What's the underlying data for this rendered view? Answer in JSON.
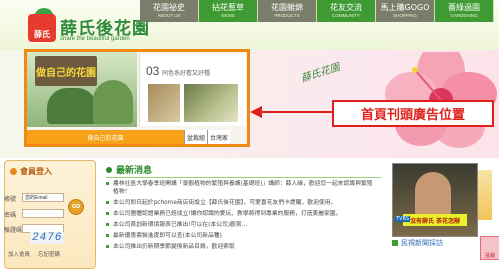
{
  "brand": {
    "logo_text": "薛氏",
    "title": "薛氏後花園",
    "subtitle": "share the beautiful garden"
  },
  "nav": [
    {
      "label": "花園祕史",
      "sublabel": "ABOUT US"
    },
    {
      "label": "拈花惹草",
      "sublabel": "NEWS"
    },
    {
      "label": "花園雜錦",
      "sublabel": "PRODUCTS"
    },
    {
      "label": "花友交流",
      "sublabel": "COMMUNITY"
    },
    {
      "label": "馬上購GOGO",
      "sublabel": "SHOPPING"
    },
    {
      "label": "薔綠過園",
      "sublabel": "GARDENING"
    }
  ],
  "banner": {
    "sign_text": "做自己的花園",
    "slide_number": "03",
    "slide_caption": "同色系好看又好種",
    "bar_caption": "做自己的花園",
    "tabs": [
      "盆栽組",
      "台灣家"
    ],
    "script_text": "薛氏花園"
  },
  "annotation": {
    "label": "首頁刊頭廣告位置",
    "arrow_color": "#e0201a"
  },
  "login": {
    "title": "會員登入",
    "account_label": "帳號",
    "account_value": "您的Email",
    "password_label": "密碼",
    "verify_label": "驗證碼",
    "go_label": "GO",
    "captcha": "2476",
    "links": [
      "加入會員",
      "忘記密碼"
    ]
  },
  "news": {
    "title": "最新消息",
    "items": [
      "農林社區大學春季班開講「景觀植物的繁殖與養護(基礎班)」講師：薛人緣，歡迎您一起來認識與繁殖植物！",
      "本公司即日起於pchome商店街設立【薛氏後花園】，可愛喜花友們卡提醒，歡迎使用。",
      "本公司團體認證業務已經成立!讓你認識的愛玩、教學將得到專業的服務，打造美麗家園。",
      "本公司首創新環境報表已推出!可以在(本公司)觀賞…",
      "最新優惠套裝進度即可以查(本公司新品種)",
      "本公司推出仍新期季節變換新品目錄，歡迎索取"
    ]
  },
  "video": {
    "caption": "沒有薛氏 茶花怎辦",
    "logo": "TVBS",
    "label": "民視新聞採訪"
  },
  "side_badge": "盆栽"
}
